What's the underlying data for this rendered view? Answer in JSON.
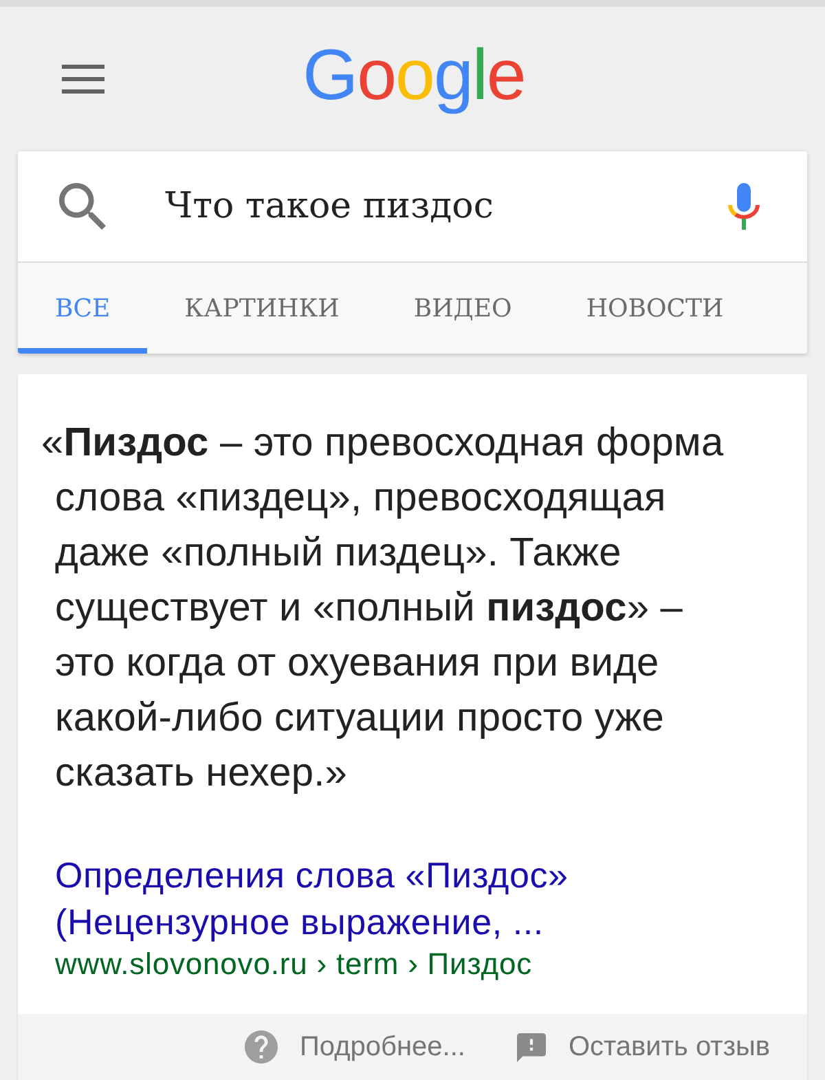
{
  "logo": {
    "text": "Google"
  },
  "search": {
    "value": "Что такое пиздос"
  },
  "tabs": [
    {
      "label": "ВСЕ",
      "selected": true
    },
    {
      "label": "КАРТИНКИ",
      "selected": false
    },
    {
      "label": "ВИДЕО",
      "selected": false
    },
    {
      "label": "НОВОСТИ",
      "selected": false
    }
  ],
  "result": {
    "snippet": "«**Пиздос** – это превосходная форма\nслова «пиздец», превосходящая\nдаже «полный пиздец». Также\nсуществует и «полный **пиздос**» –\nэто когда от охуевания при виде\nкакой-либо ситуации просто уже\nсказать нехер.»",
    "title": "Определения слова «Пиздос»\n(Нецензурное выражение, ...",
    "url": "www.slovonovo.ru › term › Пиздос"
  },
  "footer": [
    {
      "kind": "help",
      "label": "Подробнее..."
    },
    {
      "kind": "feedback",
      "label": "Оставить отзыв"
    }
  ]
}
